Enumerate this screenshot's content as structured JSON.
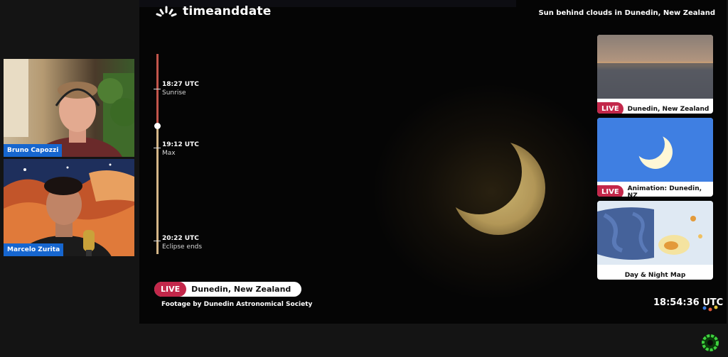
{
  "brand": {
    "name": "timeanddate"
  },
  "headline": "Sun behind clouds in Dunedin, New Zealand",
  "timeline": [
    {
      "time": "18:27 UTC",
      "label": "Sunrise"
    },
    {
      "time": "19:12 UTC",
      "label": "Max"
    },
    {
      "time": "20:22 UTC",
      "label": "Eclipse ends"
    }
  ],
  "live": {
    "badge": "LIVE",
    "location": "Dunedin, New Zealand"
  },
  "credit": "Footage by Dunedin Astronomical Society",
  "clock": "18:54:36 UTC",
  "cards": [
    {
      "badge": "LIVE",
      "caption": "Dunedin, New Zealand"
    },
    {
      "badge": "LIVE",
      "caption": "Animation: Dunedin, NZ"
    },
    {
      "caption": "Day & Night Map"
    }
  ],
  "participants": [
    {
      "name": "Bruno Capozzi"
    },
    {
      "name": "Marcelo Zurita"
    }
  ],
  "colors": {
    "live_red": "#c3274a",
    "name_tag_blue": "#1666cf",
    "timeline_red": "#c2554b",
    "timeline_tan": "#d4b688"
  },
  "icons": [
    "timeanddate-logo-icon",
    "clock-deco-icon",
    "green-ring-icon"
  ]
}
